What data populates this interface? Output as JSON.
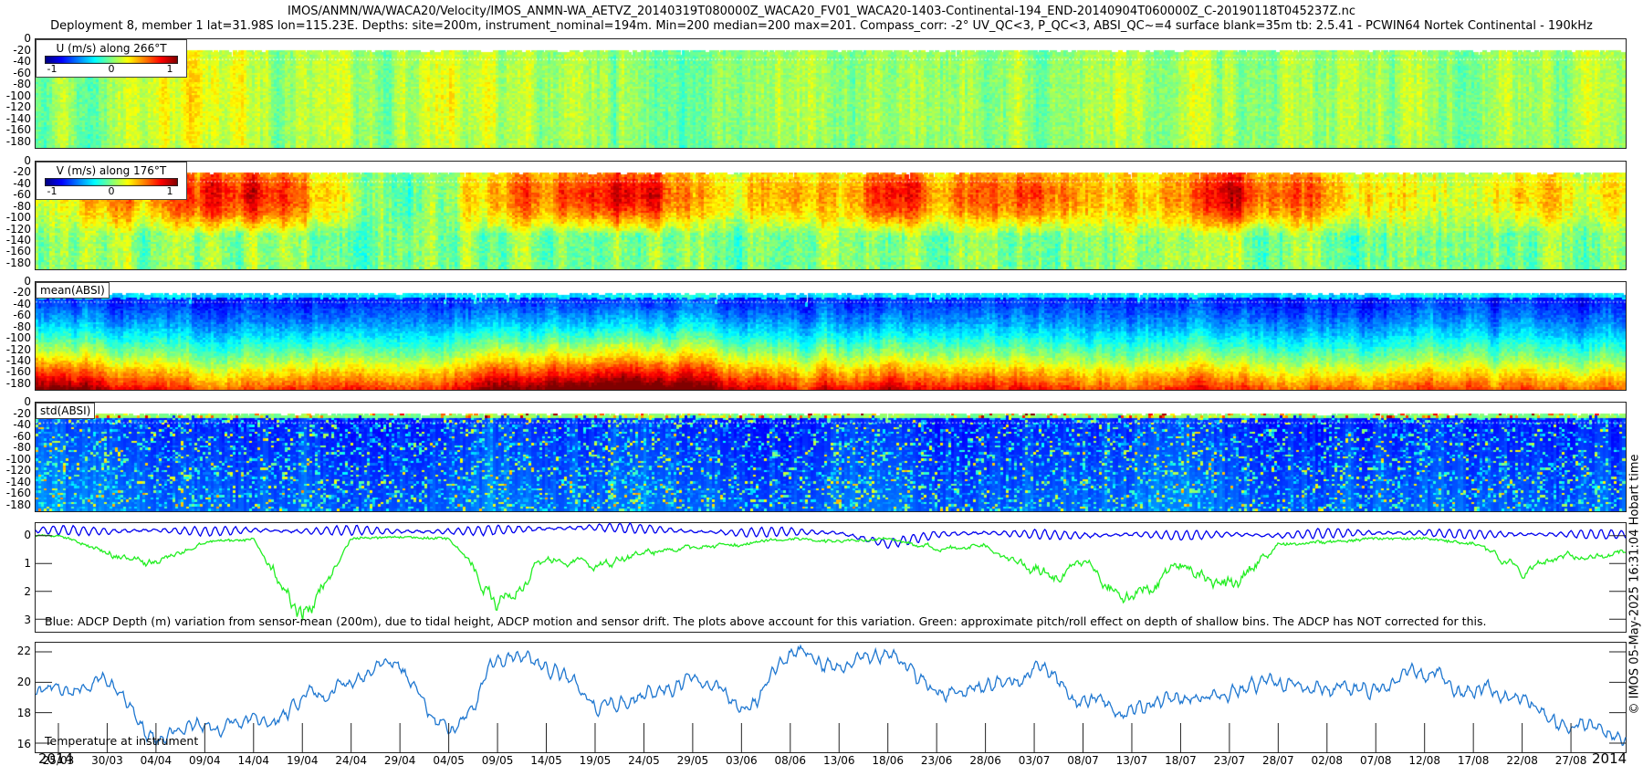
{
  "title": {
    "line1": "IMOS/ANMN/WA/WACA20/Velocity/IMOS_ANMN-WA_AETVZ_20140319T080000Z_WACA20_FV01_WACA20-1403-Continental-194_END-20140904T060000Z_C-20190118T045237Z.nc",
    "line2": "Deployment 8, member 1 lat=31.98S lon=115.23E. Depths: site=200m, instrument_nominal=194m. Min=200 median=200 max=201. Compass_corr: -2° UV_QC<3, P_QC<3, ABSI_QC~=4 surface blank=35m tb: 2.5.41 - PCWIN64 Nortek Continental - 190kHz"
  },
  "credit": "© IMOS 05-May-2025 16:31:04 Hobart time",
  "x_axis": {
    "year_left": "2014",
    "year_right": "2014",
    "ticks": [
      "25/03",
      "30/03",
      "04/04",
      "09/04",
      "14/04",
      "19/04",
      "24/04",
      "29/04",
      "04/05",
      "09/05",
      "14/05",
      "19/05",
      "24/05",
      "29/05",
      "03/06",
      "08/06",
      "13/06",
      "18/06",
      "23/06",
      "28/06",
      "03/07",
      "08/07",
      "13/07",
      "18/07",
      "23/07",
      "28/07",
      "02/08",
      "07/08",
      "12/08",
      "17/08",
      "22/08",
      "27/08"
    ]
  },
  "colormap": "jet",
  "chart_data": [
    {
      "type": "heatmap",
      "id": "u",
      "legend_title": "U (m/s) along 266°T",
      "colorbar_ticks": [
        "-1",
        "0",
        "1"
      ],
      "clim": [
        -1.25,
        1.25
      ],
      "ylim": [
        -193,
        0
      ],
      "yticks": [
        "0",
        "-20",
        "-40",
        "-60",
        "-80",
        "-100",
        "-120",
        "-140",
        "-160",
        "-180"
      ],
      "surface_blank_m": -35,
      "values_at_ticks": [
        0.05,
        0.1,
        0.15,
        0.3,
        0.1,
        0.05,
        0.1,
        0.0,
        0.35,
        0.1,
        0.05,
        0.1,
        0.0,
        0.05,
        0.1,
        0.2,
        0.1,
        0.05,
        0.1,
        0.0,
        0.05,
        0.1,
        0.2,
        0.05,
        0.1,
        0.0,
        0.1,
        0.05,
        0.1,
        0.0,
        0.1,
        0.05
      ]
    },
    {
      "type": "heatmap",
      "id": "v",
      "legend_title": "V (m/s) along 176°T",
      "colorbar_ticks": [
        "-1",
        "0",
        "1"
      ],
      "clim": [
        -1.25,
        1.25
      ],
      "ylim": [
        -193,
        0
      ],
      "yticks": [
        "0",
        "-20",
        "-40",
        "-60",
        "-80",
        "-100",
        "-120",
        "-140",
        "-160",
        "-180"
      ],
      "surface_blank_m": -35,
      "values_at_ticks": [
        0.2,
        0.5,
        0.55,
        0.85,
        0.9,
        0.6,
        0.3,
        -0.15,
        0.1,
        0.6,
        0.7,
        0.95,
        1.0,
        0.5,
        0.4,
        0.6,
        0.3,
        1.0,
        0.6,
        0.65,
        0.85,
        0.5,
        0.35,
        0.5,
        0.95,
        0.7,
        0.6,
        0.4,
        0.25,
        0.2,
        0.5,
        0.3
      ]
    },
    {
      "type": "heatmap",
      "id": "mean_absi",
      "label": "mean(ABSI)",
      "ylim": [
        -193,
        0
      ],
      "yticks": [
        "0",
        "-20",
        "-40",
        "-60",
        "-80",
        "-100",
        "-120",
        "-140",
        "-160",
        "-180"
      ],
      "surface_blank_m": -35,
      "values_at_ticks": [
        0.6,
        0.55,
        0.5,
        0.45,
        0.45,
        0.5,
        0.5,
        0.45,
        0.5,
        0.6,
        0.6,
        0.65,
        0.65,
        0.6,
        0.55,
        0.5,
        0.5,
        0.55,
        0.5,
        0.5,
        0.5,
        0.45,
        0.45,
        0.5,
        0.5,
        0.45,
        0.45,
        0.45,
        0.45,
        0.45,
        0.45,
        0.45
      ]
    },
    {
      "type": "heatmap",
      "id": "std_absi",
      "label": "std(ABSI)",
      "ylim": [
        -193,
        0
      ],
      "yticks": [
        "0",
        "-20",
        "-40",
        "-60",
        "-80",
        "-100",
        "-120",
        "-140",
        "-160",
        "-180"
      ],
      "surface_blank_m": -35,
      "values_at_ticks": [
        0.15,
        0.15,
        0.12,
        0.12,
        0.1,
        0.12,
        0.1,
        0.1,
        0.12,
        0.15,
        0.12,
        0.12,
        0.15,
        0.12,
        0.1,
        0.1,
        0.12,
        0.15,
        0.1,
        0.1,
        0.12,
        0.12,
        0.12,
        0.15,
        0.12,
        0.1,
        0.1,
        0.1,
        0.12,
        0.1,
        0.1,
        0.1
      ]
    },
    {
      "type": "line",
      "id": "depth",
      "note": "Blue: ADCP Depth (m) variation from sensor-mean (200m), due to tidal height, ADCP motion and sensor drift. The plots above account for this variation. Green: approximate pitch/roll effect on depth of shallow bins. The ADCP has NOT corrected for this.",
      "ylim": [
        3.45,
        -0.45
      ],
      "yticks": [
        "0",
        "1",
        "2",
        "3"
      ],
      "series": [
        {
          "color": "#0000ee",
          "values_at_ticks": [
            -0.2,
            -0.15,
            -0.2,
            -0.15,
            -0.2,
            -0.15,
            -0.2,
            -0.15,
            -0.15,
            -0.2,
            -0.25,
            -0.3,
            -0.25,
            -0.15,
            -0.1,
            -0.15,
            -0.1,
            0.3,
            -0.05,
            -0.1,
            -0.05,
            0.0,
            -0.05,
            0.0,
            -0.05,
            0.0,
            -0.1,
            -0.1,
            -0.1,
            -0.05,
            -0.05,
            -0.05
          ]
        },
        {
          "color": "#22ee22",
          "values_at_ticks": [
            0.0,
            0.6,
            1.1,
            0.3,
            0.1,
            3.0,
            0.1,
            0.05,
            0.1,
            2.4,
            0.8,
            1.2,
            0.6,
            0.4,
            0.3,
            0.1,
            0.2,
            0.1,
            0.6,
            0.3,
            1.6,
            1.0,
            2.2,
            1.2,
            2.0,
            0.3,
            0.2,
            0.1,
            0.1,
            0.3,
            1.2,
            0.6
          ]
        }
      ]
    },
    {
      "type": "line",
      "id": "temperature",
      "label": "Temperature at instrument",
      "ylim": [
        15.4,
        22.6
      ],
      "yticks": [
        "16",
        "18",
        "20",
        "22"
      ],
      "series": [
        {
          "color": "#1f77d0",
          "values_at_ticks": [
            19.2,
            19.3,
            16.5,
            17.5,
            17.6,
            18.5,
            20.0,
            20.6,
            17.0,
            22.0,
            21.0,
            18.2,
            19.5,
            20.0,
            18.5,
            21.5,
            21.0,
            22.0,
            19.5,
            20.0,
            20.5,
            18.0,
            18.5,
            19.0,
            19.0,
            19.2,
            19.5,
            19.5,
            19.8,
            19.6,
            19.0,
            17.0
          ]
        }
      ]
    }
  ]
}
